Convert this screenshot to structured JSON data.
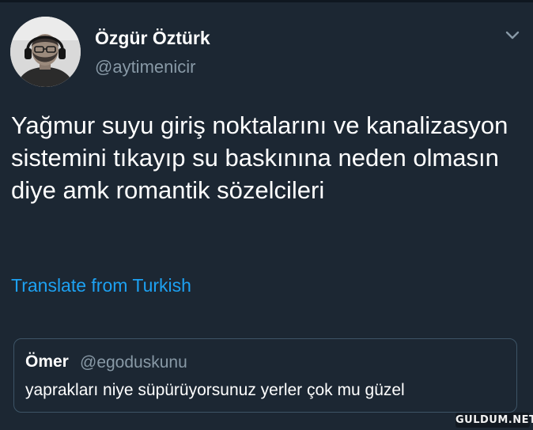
{
  "tweet": {
    "author": {
      "display_name": "Özgür Öztürk",
      "handle": "@aytimenicir"
    },
    "text": "Yağmur suyu giriş noktalarını ve kanalizasyon sistemini tıkayıp su baskınına neden olmasın diye amk romantik sözelcileri",
    "translate_label": "Translate from Turkish",
    "menu_icon": "chevron-down-icon"
  },
  "quoted_tweet": {
    "display_name": "Ömer",
    "handle": "@egoduskunu",
    "text": "yaprakları niye süpürüyorsunuz yerler çok mu güzel"
  },
  "watermark": "GULDUM.NET",
  "colors": {
    "background": "#1c2733",
    "text": "#ffffff",
    "muted": "#8899a6",
    "link": "#1da1f2",
    "border": "#3d5466"
  }
}
